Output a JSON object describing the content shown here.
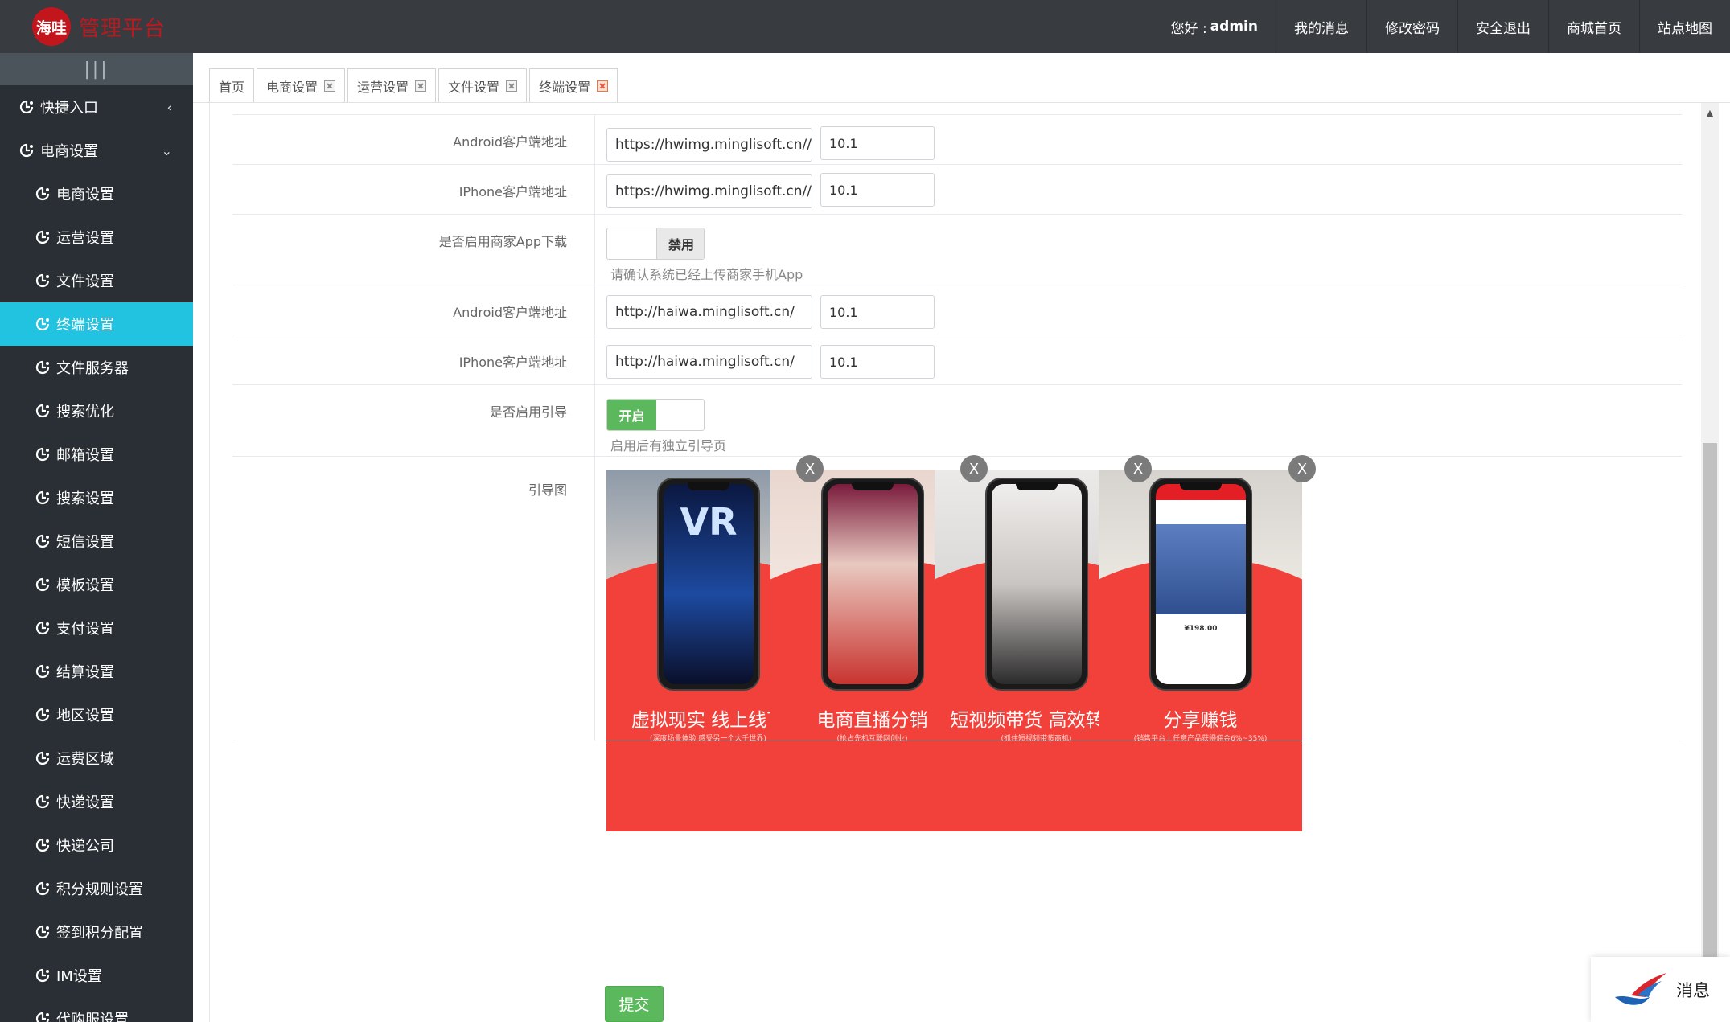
{
  "header": {
    "logo_badge": "海哇",
    "logo_title": "管理平台",
    "greeting": "您好 :",
    "username": "admin",
    "nav": [
      "我的消息",
      "修改密码",
      "安全退出",
      "商城首页",
      "站点地图"
    ]
  },
  "sidebar": {
    "toggle_icon": "|||",
    "items": [
      {
        "label": "快捷入口",
        "level": "top",
        "caret": "‹"
      },
      {
        "label": "电商设置",
        "level": "top",
        "caret": "⌄"
      },
      {
        "label": "电商设置",
        "level": "sub"
      },
      {
        "label": "运营设置",
        "level": "sub"
      },
      {
        "label": "文件设置",
        "level": "sub"
      },
      {
        "label": "终端设置",
        "level": "sub",
        "active": true
      },
      {
        "label": "文件服务器",
        "level": "sub"
      },
      {
        "label": "搜索优化",
        "level": "sub"
      },
      {
        "label": "邮箱设置",
        "level": "sub"
      },
      {
        "label": "搜索设置",
        "level": "sub"
      },
      {
        "label": "短信设置",
        "level": "sub"
      },
      {
        "label": "模板设置",
        "level": "sub"
      },
      {
        "label": "支付设置",
        "level": "sub"
      },
      {
        "label": "结算设置",
        "level": "sub"
      },
      {
        "label": "地区设置",
        "level": "sub"
      },
      {
        "label": "运费区域",
        "level": "sub"
      },
      {
        "label": "快递设置",
        "level": "sub"
      },
      {
        "label": "快递公司",
        "level": "sub"
      },
      {
        "label": "积分规则设置",
        "level": "sub"
      },
      {
        "label": "签到积分配置",
        "level": "sub"
      },
      {
        "label": "IM设置",
        "level": "sub"
      },
      {
        "label": "代购服设置",
        "level": "sub"
      }
    ]
  },
  "tabs": [
    {
      "label": "首页",
      "closable": false
    },
    {
      "label": "电商设置",
      "closable": true
    },
    {
      "label": "运营设置",
      "closable": true
    },
    {
      "label": "文件设置",
      "closable": true
    },
    {
      "label": "终端设置",
      "closable": true,
      "active": true
    }
  ],
  "form": {
    "merchant_android_label": "Android客户端地址",
    "merchant_android_url": "https://hwimg.minglisoft.cn//upload/system",
    "merchant_android_version": "10.1",
    "merchant_iphone_label": "IPhone客户端地址",
    "merchant_iphone_url": "https://hwimg.minglisoft.cn//upload/system",
    "merchant_iphone_version": "10.1",
    "merchant_app_label": "是否启用商家App下载",
    "merchant_app_toggle": "禁用",
    "merchant_app_hint": "请确认系统已经上传商家手机App",
    "client_android_label": "Android客户端地址",
    "client_android_url": "http://haiwa.minglisoft.cn/",
    "client_android_version": "10.1",
    "client_iphone_label": "IPhone客户端地址",
    "client_iphone_url": "http://haiwa.minglisoft.cn/",
    "client_iphone_version": "10.1",
    "guide_label": "是否启用引导",
    "guide_toggle": "开启",
    "guide_hint": "启用后有独立引导页",
    "guide_images_label": "引导图",
    "guide_images": [
      {
        "title": "虚拟现实 线上线下",
        "sub": "(深度场景体验 感受另一个大千世界)",
        "screen_text": "VR"
      },
      {
        "title": "电商直播分销",
        "sub": "(抢占先机互联网创业)",
        "screen_text": ""
      },
      {
        "title": "短视频带货 高效转化",
        "sub": "(抓住短视频带货商机)",
        "screen_text": ""
      },
      {
        "title": "分享赚钱",
        "sub": "(销售平台上任意产品获得佣金6%~35%)",
        "screen_text": "¥198.00"
      }
    ],
    "remove_label": "X",
    "submit_label": "提交"
  },
  "message_widget": {
    "label": "消息"
  },
  "colors": {
    "header_bg": "#383c41",
    "sidebar_bg": "#2a2f35",
    "sidebar_active": "#21c3e0",
    "success": "#5cb85c",
    "guide_red": "#f2413a"
  }
}
